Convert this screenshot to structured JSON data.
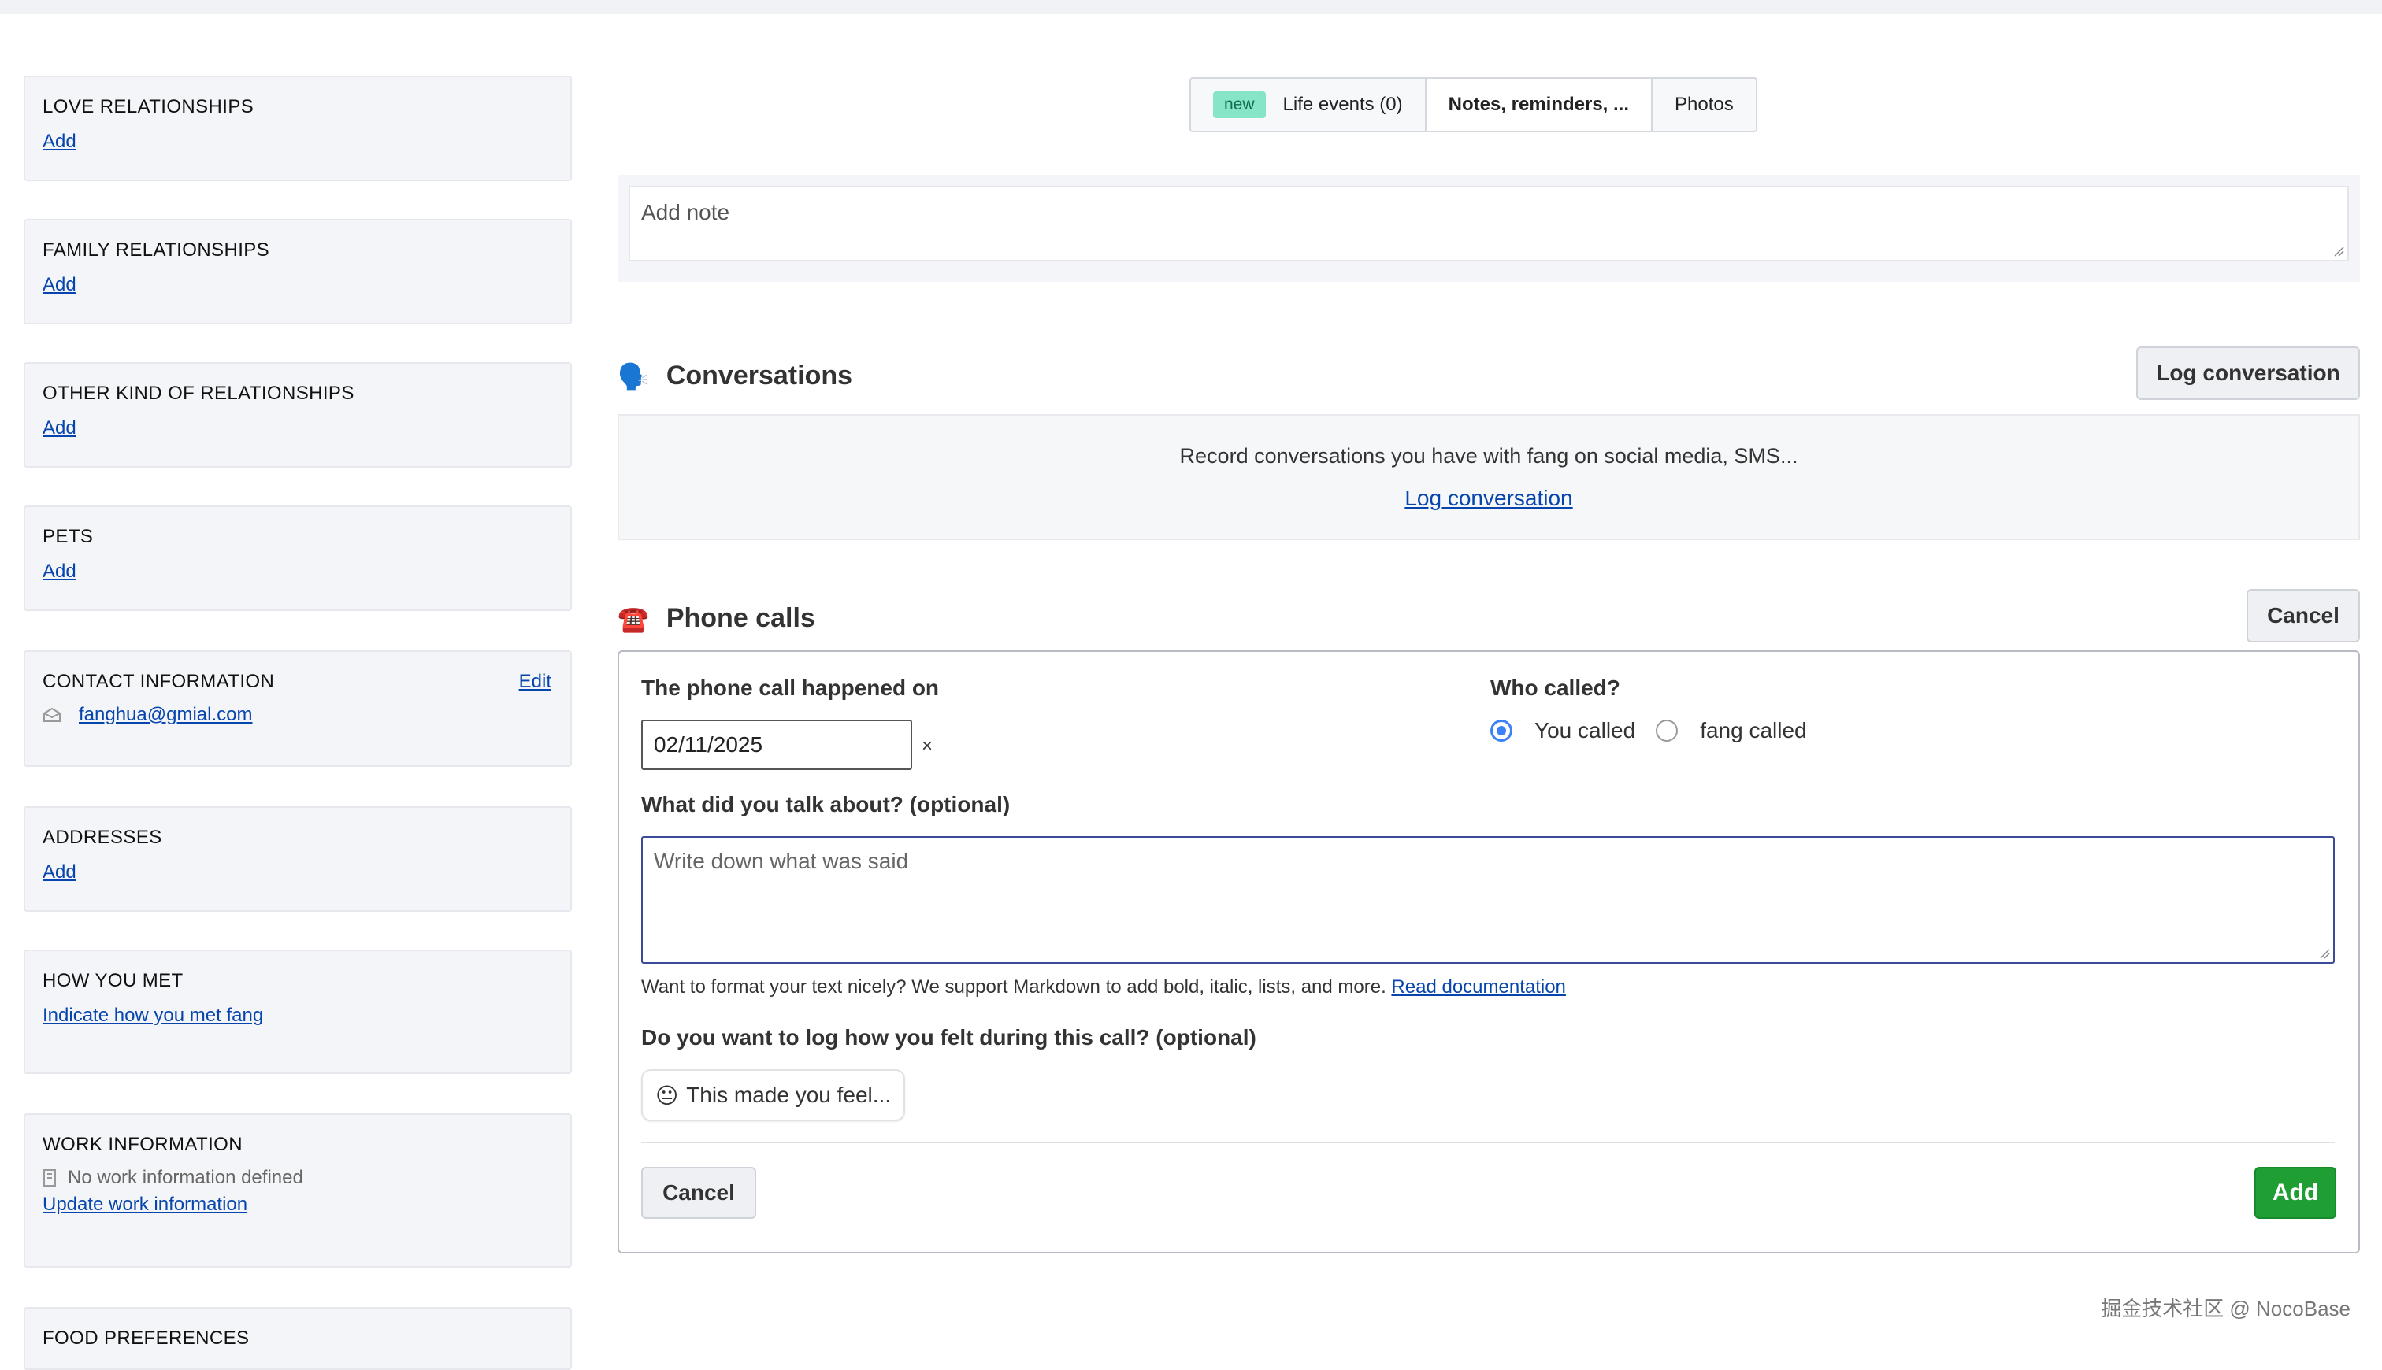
{
  "sidebar": {
    "love": {
      "title": "LOVE RELATIONSHIPS",
      "link": "Add"
    },
    "family": {
      "title": "FAMILY RELATIONSHIPS",
      "link": "Add"
    },
    "other": {
      "title": "OTHER KIND OF RELATIONSHIPS",
      "link": "Add"
    },
    "pets": {
      "title": "PETS",
      "link": "Add"
    },
    "contact": {
      "title": "CONTACT INFORMATION",
      "edit": "Edit",
      "email": "fanghua@gmial.com"
    },
    "addresses": {
      "title": "ADDRESSES",
      "link": "Add"
    },
    "how_met": {
      "title": "HOW YOU MET",
      "link": "Indicate how you met fang"
    },
    "work": {
      "title": "WORK INFORMATION",
      "empty": "No work information defined",
      "link": "Update work information"
    },
    "food": {
      "title": "FOOD PREFERENCES"
    }
  },
  "tabs": {
    "badge": "new",
    "life_events": "Life events (0)",
    "notes": "Notes, reminders, ...",
    "photos": "Photos"
  },
  "note": {
    "placeholder": "Add note"
  },
  "conversations": {
    "icon": "🗣️",
    "title": "Conversations",
    "button": "Log conversation",
    "empty_text": "Record conversations you have with fang on social media, SMS...",
    "empty_link": "Log conversation"
  },
  "phone_calls": {
    "icon": "☎️",
    "title": "Phone calls",
    "cancel_top": "Cancel",
    "date_label": "The phone call happened on",
    "date_value": "02/11/2025",
    "clear": "×",
    "who_label": "Who called?",
    "option_you": "You called",
    "option_them": "fang called",
    "talk_label": "What did you talk about? (optional)",
    "talk_placeholder": "Write down what was said",
    "help_text": "Want to format your text nicely? We support Markdown to add bold, italic, lists, and more.",
    "help_link": "Read documentation",
    "feel_label": "Do you want to log how you felt during this call? (optional)",
    "feel_emoji": "😐",
    "feel_button": "This made you feel...",
    "cancel_bottom": "Cancel",
    "add": "Add"
  },
  "watermark": "掘金技术社区 @ NocoBase",
  "colors": {
    "link": "#0645ad",
    "accent_green": "#1f9e34",
    "radio_blue": "#3b82f6",
    "badge_new": "#86e5c6"
  }
}
